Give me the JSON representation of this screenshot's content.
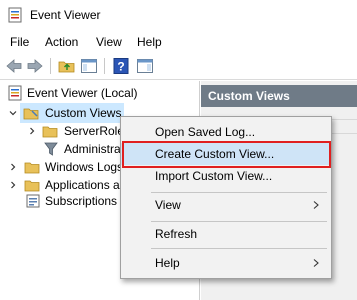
{
  "window": {
    "title": "Event Viewer"
  },
  "menubar": {
    "items": [
      "File",
      "Action",
      "View",
      "Help"
    ]
  },
  "tree": {
    "items": [
      {
        "label": "Event Viewer (Local)",
        "icon": "event-viewer-icon"
      },
      {
        "label": "Custom Views",
        "icon": "folder-icon"
      },
      {
        "label": "ServerRole",
        "icon": "folder-icon"
      },
      {
        "label": "Administra",
        "icon": "filter-icon"
      },
      {
        "label": "Windows Logs",
        "icon": "folder-icon"
      },
      {
        "label": "Applications a",
        "icon": "folder-icon"
      },
      {
        "label": "Subscriptions",
        "icon": "subscriptions-icon"
      }
    ]
  },
  "right_pane": {
    "header": "Custom Views"
  },
  "context_menu": {
    "items": [
      {
        "label": "Open Saved Log..."
      },
      {
        "label": "Create Custom View...",
        "highlighted": true
      },
      {
        "label": "Import Custom View..."
      },
      {
        "label": "View",
        "submenu": true
      },
      {
        "label": "Refresh"
      },
      {
        "label": "Help",
        "submenu": true
      }
    ]
  },
  "colors": {
    "selection": "#cce8ff",
    "highlight_outline": "#e02020",
    "pane_header": "#6f7b87"
  }
}
